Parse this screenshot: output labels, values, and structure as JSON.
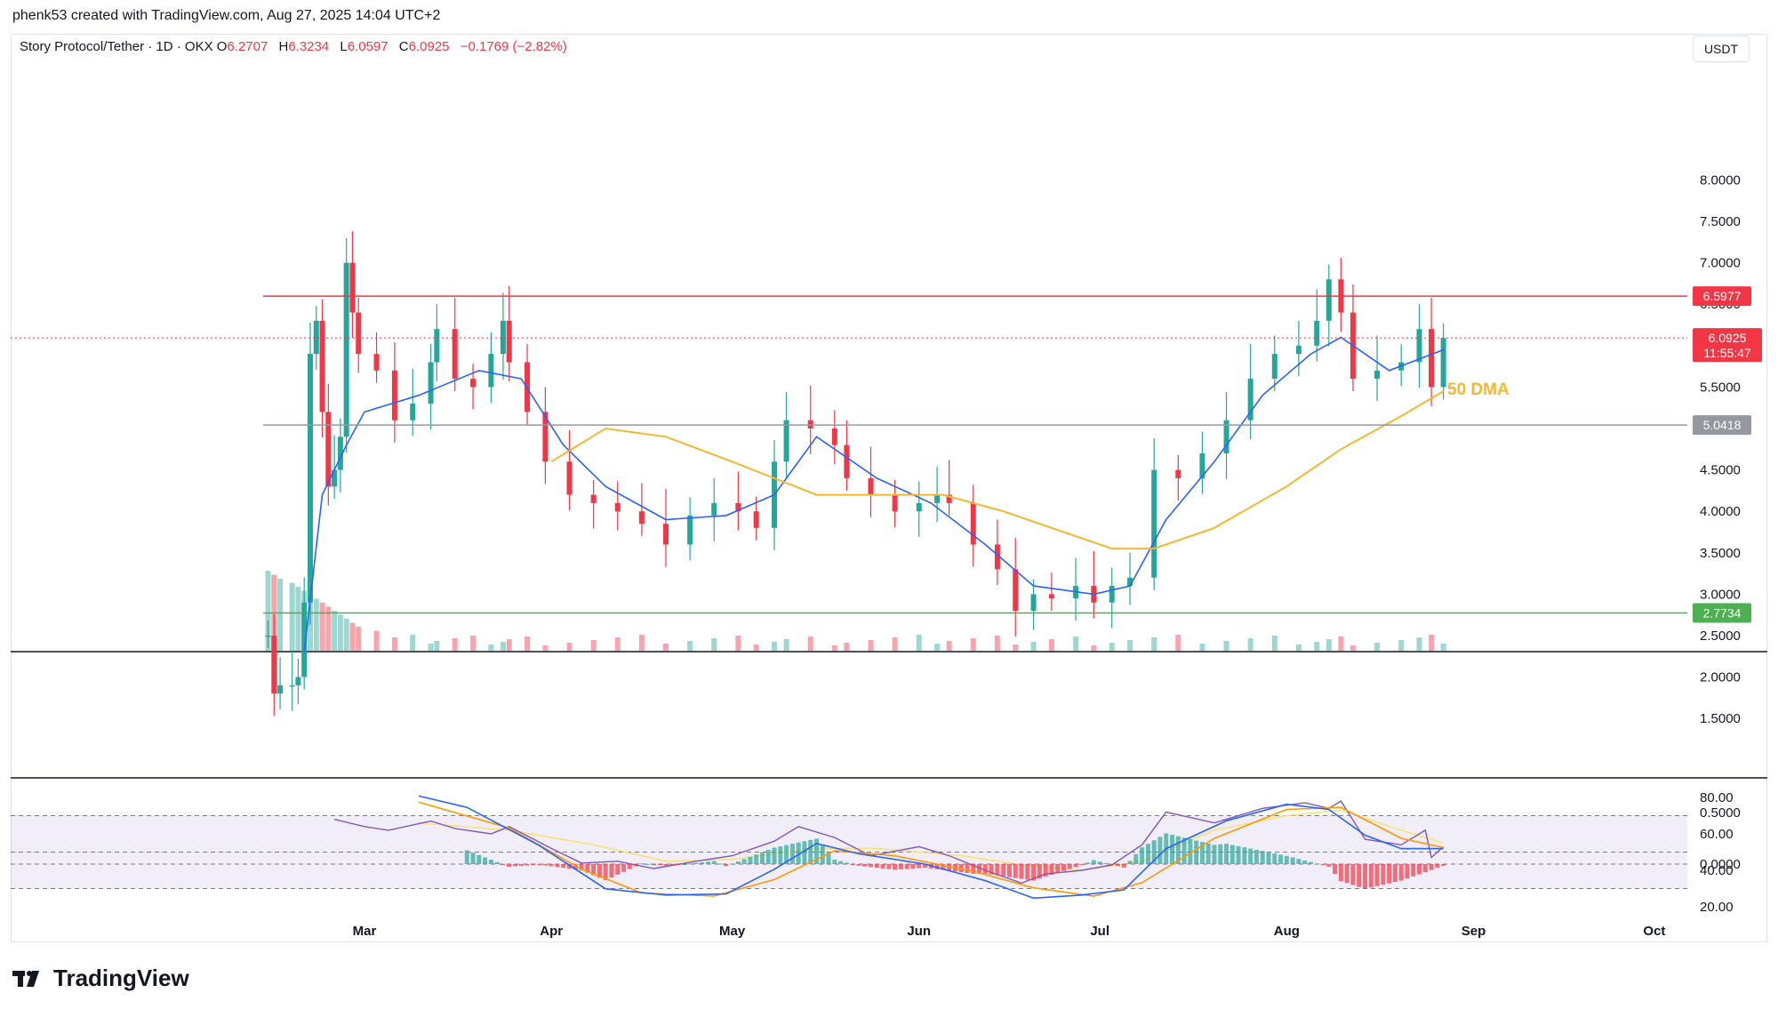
{
  "header": {
    "credit": "phenk53 created with TradingView.com, Aug 27, 2025 14:04 UTC+2"
  },
  "symbol": {
    "name": "Story Protocol/Tether · 1D · OKX",
    "o_label": "O",
    "o_value": "6.2707",
    "h_label": "H",
    "h_value": "6.3234",
    "l_label": "L",
    "l_value": "6.0597",
    "c_label": "C",
    "c_value": "6.0925",
    "change": "−0.1769 (−2.82%)"
  },
  "currency": "USDT",
  "brand": "TradingView",
  "colors": {
    "up": "#26a69a",
    "down": "#f23645",
    "ema": "#2962ff",
    "sma50": "#f5b731",
    "resistance": "#f23645",
    "support_mid": "#9598a1",
    "support_low": "#4caf50",
    "rsi": "#7e57c2",
    "rsi_ma": "#f5e27a",
    "macd": "#2962ff",
    "signal": "#ff9800"
  },
  "chart_data": {
    "type": "candlestick",
    "price_axis": {
      "ticks": [
        "8.0000",
        "7.5000",
        "7.0000",
        "6.5000",
        "5.5000",
        "4.5000",
        "4.0000",
        "3.5000",
        "3.0000",
        "2.5000",
        "2.0000",
        "1.5000"
      ],
      "ylim": [
        1.0,
        8.2
      ]
    },
    "time_axis": [
      "Mar",
      "Apr",
      "May",
      "Jun",
      "Jul",
      "Aug",
      "Sep",
      "Oct"
    ],
    "horizontal_levels": [
      {
        "value": 6.5977,
        "label": "6.5977",
        "color": "resistance"
      },
      {
        "value": 5.0418,
        "label": "5.0418",
        "color": "support_mid"
      },
      {
        "value": 2.7734,
        "label": "2.7734",
        "color": "support_low"
      }
    ],
    "last_price": {
      "value": 6.0925,
      "label": "6.0925",
      "countdown": "11:55:47"
    },
    "annotation": "50 DMA",
    "close_path": [
      [
        "Feb 13",
        2.5
      ],
      [
        "Feb 14",
        1.8
      ],
      [
        "Feb 15",
        1.9
      ],
      [
        "Feb 17",
        1.9
      ],
      [
        "Feb 18",
        2.0
      ],
      [
        "Feb 19",
        2.9
      ],
      [
        "Feb 20",
        5.9
      ],
      [
        "Feb 21",
        6.3
      ],
      [
        "Feb 22",
        5.2
      ],
      [
        "Feb 23",
        4.3
      ],
      [
        "Feb 24",
        4.5
      ],
      [
        "Feb 25",
        4.9
      ],
      [
        "Feb 26",
        7.0
      ],
      [
        "Feb 27",
        6.4
      ],
      [
        "Feb 28",
        5.9
      ],
      [
        "Mar 3",
        5.7
      ],
      [
        "Mar 6",
        5.1
      ],
      [
        "Mar 9",
        5.3
      ],
      [
        "Mar 12",
        5.8
      ],
      [
        "Mar 13",
        6.2
      ],
      [
        "Mar 16",
        5.6
      ],
      [
        "Mar 19",
        5.5
      ],
      [
        "Mar 22",
        5.9
      ],
      [
        "Mar 24",
        6.3
      ],
      [
        "Mar 25",
        5.8
      ],
      [
        "Mar 28",
        5.2
      ],
      [
        "Mar 31",
        4.6
      ],
      [
        "Apr 4",
        4.2
      ],
      [
        "Apr 8",
        4.1
      ],
      [
        "Apr 12",
        4.0
      ],
      [
        "Apr 16",
        3.85
      ],
      [
        "Apr 20",
        3.6
      ],
      [
        "Apr 24",
        3.95
      ],
      [
        "Apr 28",
        4.1
      ],
      [
        "May 2",
        4.0
      ],
      [
        "May 5",
        3.8
      ],
      [
        "May 8",
        4.6
      ],
      [
        "May 10",
        5.1
      ],
      [
        "May 14",
        5.0
      ],
      [
        "May 18",
        4.8
      ],
      [
        "May 20",
        4.4
      ],
      [
        "May 24",
        4.2
      ],
      [
        "May 28",
        4.0
      ],
      [
        "Jun 1",
        4.1
      ],
      [
        "Jun 4",
        4.2
      ],
      [
        "Jun 6",
        4.1
      ],
      [
        "Jun 10",
        3.6
      ],
      [
        "Jun 14",
        3.3
      ],
      [
        "Jun 17",
        2.8
      ],
      [
        "Jun 20",
        3.0
      ],
      [
        "Jun 23",
        2.95
      ],
      [
        "Jun 27",
        3.1
      ],
      [
        "Jun 30",
        2.9
      ],
      [
        "Jul 3",
        3.1
      ],
      [
        "Jul 6",
        3.2
      ],
      [
        "Jul 10",
        4.5
      ],
      [
        "Jul 14",
        4.4
      ],
      [
        "Jul 18",
        4.7
      ],
      [
        "Jul 22",
        5.1
      ],
      [
        "Jul 26",
        5.6
      ],
      [
        "Jul 30",
        5.9
      ],
      [
        "Aug 3",
        6.0
      ],
      [
        "Aug 6",
        6.3
      ],
      [
        "Aug 8",
        6.8
      ],
      [
        "Aug 10",
        6.4
      ],
      [
        "Aug 12",
        5.6
      ],
      [
        "Aug 16",
        5.7
      ],
      [
        "Aug 20",
        5.8
      ],
      [
        "Aug 23",
        6.2
      ],
      [
        "Aug 25",
        5.5
      ],
      [
        "Aug 27",
        6.0925
      ]
    ],
    "ema_path": [
      [
        "Feb 19",
        2.3
      ],
      [
        "Feb 22",
        4.2
      ],
      [
        "Feb 26",
        4.8
      ],
      [
        "Mar 1",
        5.2
      ],
      [
        "Mar 10",
        5.4
      ],
      [
        "Mar 20",
        5.7
      ],
      [
        "Mar 27",
        5.6
      ],
      [
        "Apr 3",
        4.8
      ],
      [
        "Apr 10",
        4.3
      ],
      [
        "Apr 20",
        3.9
      ],
      [
        "Apr 30",
        3.95
      ],
      [
        "May 8",
        4.2
      ],
      [
        "May 15",
        4.9
      ],
      [
        "May 25",
        4.4
      ],
      [
        "Jun 3",
        4.1
      ],
      [
        "Jun 12",
        3.6
      ],
      [
        "Jun 20",
        3.1
      ],
      [
        "Jun 30",
        3.0
      ],
      [
        "Jul 6",
        3.1
      ],
      [
        "Jul 12",
        3.9
      ],
      [
        "Jul 20",
        4.6
      ],
      [
        "Jul 28",
        5.4
      ],
      [
        "Aug 5",
        5.9
      ],
      [
        "Aug 10",
        6.1
      ],
      [
        "Aug 18",
        5.7
      ],
      [
        "Aug 27",
        5.95
      ]
    ],
    "sma50_path": [
      [
        "Apr 1",
        4.6
      ],
      [
        "Apr 10",
        5.0
      ],
      [
        "Apr 20",
        4.9
      ],
      [
        "May 1",
        4.6
      ],
      [
        "May 15",
        4.2
      ],
      [
        "May 25",
        4.2
      ],
      [
        "Jun 5",
        4.2
      ],
      [
        "Jun 15",
        4.0
      ],
      [
        "Jun 25",
        3.75
      ],
      [
        "Jul 3",
        3.55
      ],
      [
        "Jul 10",
        3.55
      ],
      [
        "Jul 20",
        3.8
      ],
      [
        "Aug 1",
        4.3
      ],
      [
        "Aug 10",
        4.75
      ],
      [
        "Aug 20",
        5.15
      ],
      [
        "Aug 27",
        5.45
      ]
    ],
    "rsi": {
      "ticks": [
        "80.00",
        "60.00",
        "40.00",
        "20.00"
      ],
      "upper": 70,
      "lower": 30,
      "mid": 50,
      "path": [
        [
          "Feb 24",
          68
        ],
        [
          "Mar 1",
          64
        ],
        [
          "Mar 5",
          62
        ],
        [
          "Mar 12",
          67
        ],
        [
          "Mar 16",
          63
        ],
        [
          "Mar 22",
          60
        ],
        [
          "Mar 25",
          64
        ],
        [
          "Apr 1",
          52
        ],
        [
          "Apr 6",
          44
        ],
        [
          "Apr 12",
          45
        ],
        [
          "Apr 18",
          41
        ],
        [
          "Apr 25",
          45
        ],
        [
          "May 1",
          48
        ],
        [
          "May 8",
          56
        ],
        [
          "May 12",
          64
        ],
        [
          "May 18",
          58
        ],
        [
          "May 24",
          48
        ],
        [
          "Jun 1",
          53
        ],
        [
          "Jun 6",
          48
        ],
        [
          "Jun 12",
          40
        ],
        [
          "Jun 18",
          33
        ],
        [
          "Jun 22",
          38
        ],
        [
          "Jun 28",
          40
        ],
        [
          "Jul 3",
          43
        ],
        [
          "Jul 8",
          54
        ],
        [
          "Jul 12",
          72
        ],
        [
          "Jul 20",
          66
        ],
        [
          "Jul 28",
          74
        ],
        [
          "Aug 4",
          77
        ],
        [
          "Aug 8",
          74
        ],
        [
          "Aug 10",
          78
        ],
        [
          "Aug 14",
          57
        ],
        [
          "Aug 20",
          54
        ],
        [
          "Aug 24",
          62
        ],
        [
          "Aug 25",
          47
        ],
        [
          "Aug 27",
          53
        ]
      ],
      "ma_path": [
        [
          "Mar 10",
          66
        ],
        [
          "Mar 25",
          62
        ],
        [
          "Apr 8",
          54
        ],
        [
          "Apr 20",
          45
        ],
        [
          "May 1",
          46
        ],
        [
          "May 15",
          52
        ],
        [
          "May 25",
          52
        ],
        [
          "Jun 8",
          48
        ],
        [
          "Jun 18",
          43
        ],
        [
          "Jun 28",
          40
        ],
        [
          "Jul 8",
          45
        ],
        [
          "Jul 20",
          62
        ],
        [
          "Aug 1",
          70
        ],
        [
          "Aug 10",
          73
        ],
        [
          "Aug 20",
          62
        ],
        [
          "Aug 27",
          55
        ]
      ]
    },
    "macd": {
      "ticks": [
        "0.5000",
        "0.0000"
      ],
      "macd_path": [
        [
          "Mar 10",
          0.66
        ],
        [
          "Mar 18",
          0.55
        ],
        [
          "Mar 30",
          0.18
        ],
        [
          "Apr 10",
          -0.24
        ],
        [
          "Apr 20",
          -0.3
        ],
        [
          "Apr 30",
          -0.29
        ],
        [
          "May 8",
          -0.05
        ],
        [
          "May 15",
          0.2
        ],
        [
          "May 22",
          0.1
        ],
        [
          "Jun 2",
          0.0
        ],
        [
          "Jun 12",
          -0.16
        ],
        [
          "Jun 20",
          -0.33
        ],
        [
          "Jun 28",
          -0.3
        ],
        [
          "Jul 5",
          -0.25
        ],
        [
          "Jul 12",
          0.15
        ],
        [
          "Jul 22",
          0.42
        ],
        [
          "Aug 1",
          0.58
        ],
        [
          "Aug 8",
          0.53
        ],
        [
          "Aug 14",
          0.28
        ],
        [
          "Aug 20",
          0.15
        ],
        [
          "Aug 27",
          0.15
        ]
      ],
      "signal_path": [
        [
          "Mar 10",
          0.6
        ],
        [
          "Mar 25",
          0.35
        ],
        [
          "Apr 6",
          -0.05
        ],
        [
          "Apr 16",
          -0.28
        ],
        [
          "Apr 28",
          -0.31
        ],
        [
          "May 8",
          -0.15
        ],
        [
          "May 18",
          0.13
        ],
        [
          "May 28",
          0.08
        ],
        [
          "Jun 10",
          -0.07
        ],
        [
          "Jun 20",
          -0.23
        ],
        [
          "Jun 30",
          -0.31
        ],
        [
          "Jul 8",
          -0.18
        ],
        [
          "Jul 20",
          0.25
        ],
        [
          "Aug 1",
          0.53
        ],
        [
          "Aug 10",
          0.55
        ],
        [
          "Aug 20",
          0.25
        ],
        [
          "Aug 27",
          0.16
        ]
      ]
    }
  }
}
